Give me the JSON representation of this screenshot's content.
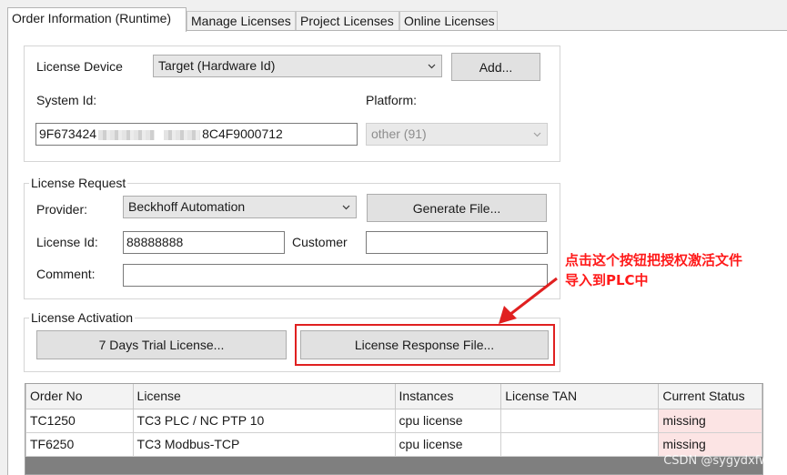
{
  "tabs": [
    {
      "label": "Order Information (Runtime)",
      "active": true
    },
    {
      "label": "Manage Licenses",
      "active": false
    },
    {
      "label": "Project Licenses",
      "active": false
    },
    {
      "label": "Online Licenses",
      "active": false
    }
  ],
  "device_section": {
    "license_device_label": "License Device",
    "license_device_value": "Target (Hardware Id)",
    "add_button": "Add...",
    "system_id_label": "System Id:",
    "system_id_prefix": "9F673424",
    "system_id_suffix": "8C4F9000712",
    "platform_label": "Platform:",
    "platform_value": "other (91)"
  },
  "license_request": {
    "legend": "License Request",
    "provider_label": "Provider:",
    "provider_value": "Beckhoff Automation",
    "generate_button": "Generate File...",
    "license_id_label": "License Id:",
    "license_id_value": "88888888",
    "customer_label": "Customer",
    "customer_value": "",
    "comment_label": "Comment:",
    "comment_value": ""
  },
  "license_activation": {
    "legend": "License Activation",
    "trial_button": "7 Days Trial License...",
    "response_button": "License Response File..."
  },
  "annotation": {
    "line1": "点击这个按钮把授权激活文件",
    "line2": "导入到PLC中",
    "color": "#ff1a1a"
  },
  "licenses_table": {
    "columns": [
      "Order No",
      "License",
      "Instances",
      "License TAN",
      "Current Status"
    ],
    "rows": [
      {
        "order_no": "TC1250",
        "license": "TC3 PLC / NC PTP 10",
        "instances": "cpu license",
        "tan": "",
        "status": "missing"
      },
      {
        "order_no": "TF6250",
        "license": "TC3 Modbus-TCP",
        "instances": "cpu license",
        "tan": "",
        "status": "missing"
      }
    ]
  },
  "watermark": "CSDN @sygydxfwd"
}
